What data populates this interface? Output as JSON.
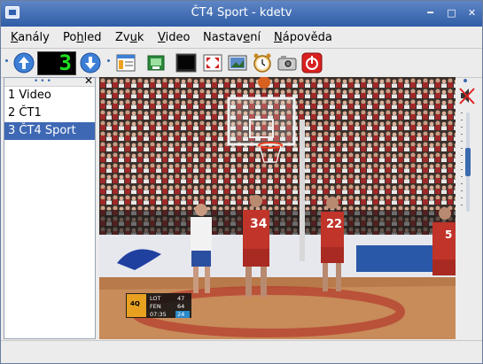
{
  "window": {
    "title": "ČT4 Sport - kdetv"
  },
  "menu": {
    "channels": {
      "pre": "",
      "u": "K",
      "post": "anály"
    },
    "view": {
      "pre": "Po",
      "u": "h",
      "post": "led"
    },
    "sound": {
      "pre": "Zv",
      "u": "u",
      "post": "k"
    },
    "video": {
      "pre": "",
      "u": "V",
      "post": "ideo"
    },
    "settings": {
      "pre": "Nastav",
      "u": "e",
      "post": "ní"
    },
    "help": {
      "pre": "",
      "u": "N",
      "post": "ápověda"
    }
  },
  "toolbar": {
    "channel_display": "3"
  },
  "channels": [
    {
      "num": "1",
      "name": "Video"
    },
    {
      "num": "2",
      "name": "ČT1"
    },
    {
      "num": "3",
      "name": "ČT4 Sport"
    }
  ],
  "video": {
    "score": [
      {
        "team": "LOT",
        "pts": "47"
      },
      {
        "team": "FEN",
        "pts": "64"
      }
    ],
    "period": "4Q",
    "clock": "07:35",
    "shot_clock": "24",
    "jerseys": [
      "34",
      "22",
      "5"
    ]
  },
  "colors": {
    "accent": "#3e68b4",
    "title_bar": "#2f5da6"
  }
}
